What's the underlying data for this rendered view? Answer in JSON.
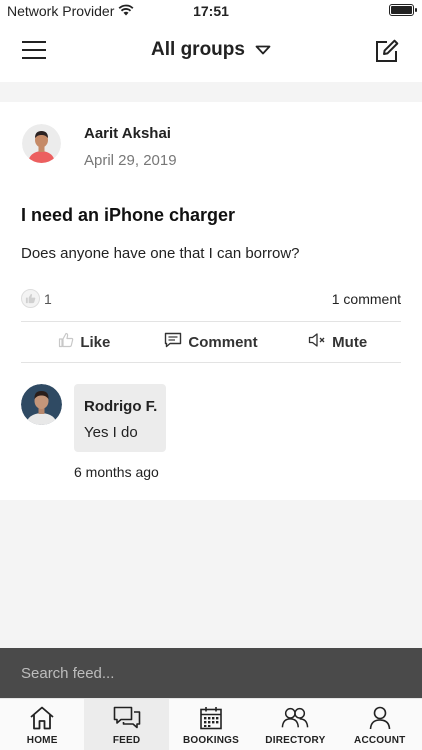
{
  "status_bar": {
    "carrier": "Network Provider",
    "time": "17:51"
  },
  "nav": {
    "title": "All groups"
  },
  "post": {
    "author": "Aarit Akshai",
    "date": "April 29, 2019",
    "title": "I need an iPhone charger",
    "body": "Does anyone have one that I can borrow?",
    "like_count": "1",
    "comment_count": "1 comment",
    "actions": {
      "like": "Like",
      "comment": "Comment",
      "mute": "Mute"
    }
  },
  "comment": {
    "author": "Rodrigo F.",
    "text": "Yes I do",
    "time": "6 months ago"
  },
  "search": {
    "placeholder": "Search feed..."
  },
  "tabs": [
    {
      "label": "HOME",
      "icon": "home-icon"
    },
    {
      "label": "FEED",
      "icon": "feed-icon",
      "active": true
    },
    {
      "label": "BOOKINGS",
      "icon": "calendar-icon"
    },
    {
      "label": "DIRECTORY",
      "icon": "people-icon"
    },
    {
      "label": "ACCOUNT",
      "icon": "person-icon"
    }
  ],
  "colors": {
    "search_bar": "#4a4a4a",
    "active_tab": "#ececec",
    "page_bg": "#f4f4f4"
  }
}
